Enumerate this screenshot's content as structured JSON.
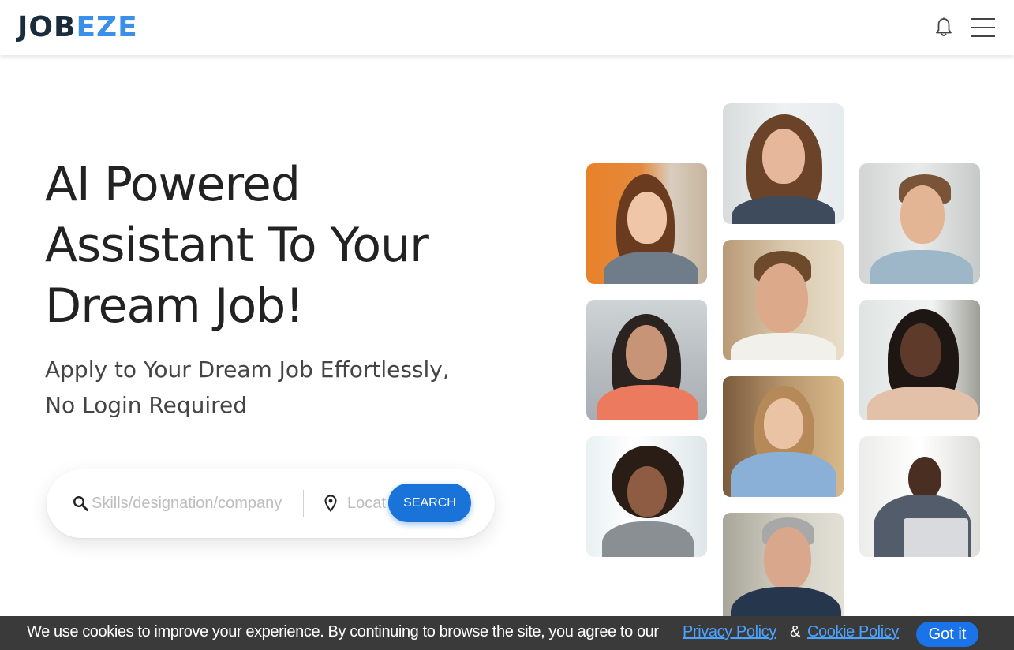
{
  "header": {
    "logo_part1": "JOB",
    "logo_part2": "EZE",
    "notification_icon": "bell-icon",
    "menu_icon": "hamburger-menu-icon"
  },
  "hero": {
    "headline_line1": "AI Powered",
    "headline_line2": "Assistant To Your",
    "headline_line3": "Dream Job!",
    "subtitle_line1": "Apply to Your Dream Job Effortlessly,",
    "subtitle_line2": "No Login Required"
  },
  "search": {
    "skills_placeholder": "Skills/designation/company",
    "skills_value": "",
    "location_placeholder": "Location",
    "location_value": "",
    "button_label": "SEARCH",
    "search_icon": "search-icon",
    "location_icon": "location-pin-icon"
  },
  "photos": {
    "items": [
      "woman-orange-background",
      "woman-long-hair",
      "woman-curly-hair",
      "woman-smiling-window",
      "man-beard-phone",
      "woman-blonde-blue-shirt",
      "man-glasses-suit",
      "man-phone-headphones",
      "woman-phone-call",
      "man-laptop-office"
    ]
  },
  "cookie": {
    "message": "We use cookies to improve your experience. By continuing to browse the site, you agree to our",
    "privacy_link": "Privacy Policy ",
    "ampersand": "&",
    "cookie_link": "Cookie Policy",
    "accept_label": "Got it"
  },
  "colors": {
    "brand_dark": "#1a2b3c",
    "brand_blue": "#3a8fe8",
    "button_blue": "#1a73d9",
    "cookie_bar": "#3a3a3a"
  }
}
